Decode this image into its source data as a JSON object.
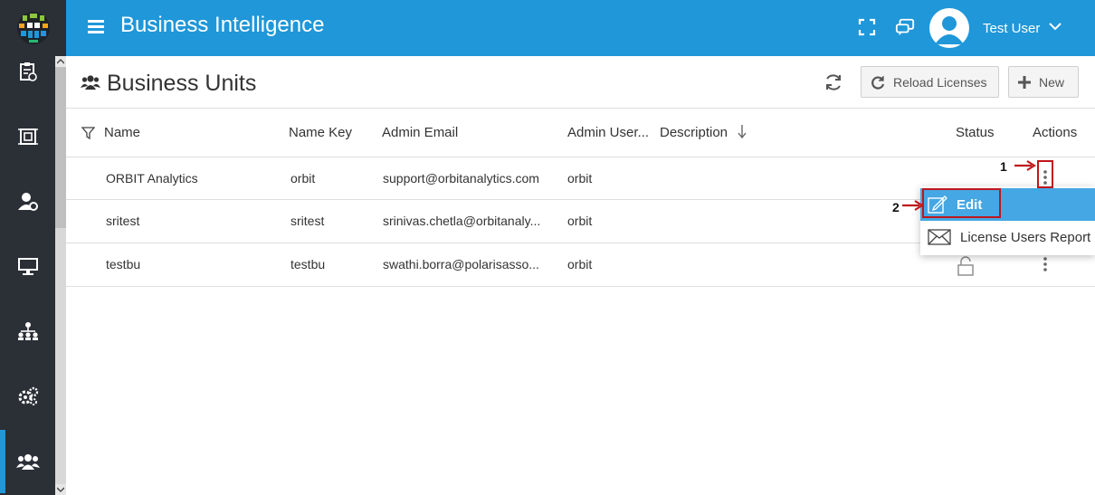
{
  "app": {
    "title": "Business Intelligence",
    "brand_color": "#1f97d9",
    "rail_color": "#2b2f36"
  },
  "header": {
    "user_name": "Test User",
    "icons": [
      "menu-icon",
      "fullscreen-icon",
      "chat-icon",
      "user-avatar-icon",
      "chevron-down-icon"
    ]
  },
  "sidebar": {
    "items": [
      {
        "icon": "clipboard-icon",
        "active": false
      },
      {
        "icon": "frame-icon",
        "active": false
      },
      {
        "icon": "user-settings-icon",
        "active": false
      },
      {
        "icon": "monitor-icon",
        "active": false
      },
      {
        "icon": "hierarchy-icon",
        "active": false
      },
      {
        "icon": "gears-icon",
        "active": false
      },
      {
        "icon": "users-icon",
        "active": true
      }
    ]
  },
  "page": {
    "title": "Business Units",
    "reload_label": "Reload Licenses",
    "new_label": "New"
  },
  "table": {
    "columns": [
      "Name",
      "Name Key",
      "Admin Email",
      "Admin User...",
      "Description",
      "Status",
      "Actions"
    ],
    "rows": [
      {
        "name": "ORBIT Analytics",
        "name_key": "orbit",
        "admin_email": "support@orbitanalytics.com",
        "admin_user": "orbit"
      },
      {
        "name": "sritest",
        "name_key": "sritest",
        "admin_email": "srinivas.chetla@orbitanaly...",
        "admin_user": "orbit"
      },
      {
        "name": "testbu",
        "name_key": "testbu",
        "admin_email": "swathi.borra@polarisasso...",
        "admin_user": "orbit"
      }
    ]
  },
  "menu": {
    "items": [
      {
        "label": "Edit",
        "icon": "edit-icon",
        "highlighted": true
      },
      {
        "label": "License Users Report",
        "icon": "envelope-icon",
        "highlighted": false
      }
    ]
  },
  "annotations": {
    "step1": "1",
    "step2": "2",
    "color": "#c0161c"
  }
}
